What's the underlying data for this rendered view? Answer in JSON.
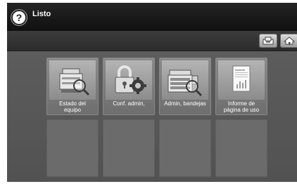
{
  "header": {
    "help_icon": "question-mark-icon",
    "help_symbol": "?",
    "status": "Listo"
  },
  "toolbar": {
    "buttons": [
      {
        "icon": "job-status-icon"
      },
      {
        "icon": "home-icon"
      }
    ]
  },
  "tiles": [
    {
      "label": "Estado del\nequipo",
      "icon": "printer-magnifier-icon"
    },
    {
      "label": "Conf. admin,",
      "icon": "padlock-gear-icon"
    },
    {
      "label": "Admin, bandejas",
      "icon": "printer-trays-magnifier-icon"
    },
    {
      "label": "Informe de\npágina de uso",
      "icon": "usage-report-icon"
    }
  ],
  "colors": {
    "background": "#5a5a5a",
    "top_bar": "#141414",
    "tile": "#7c7c7c",
    "empty_tile": "#6b6b6b"
  }
}
